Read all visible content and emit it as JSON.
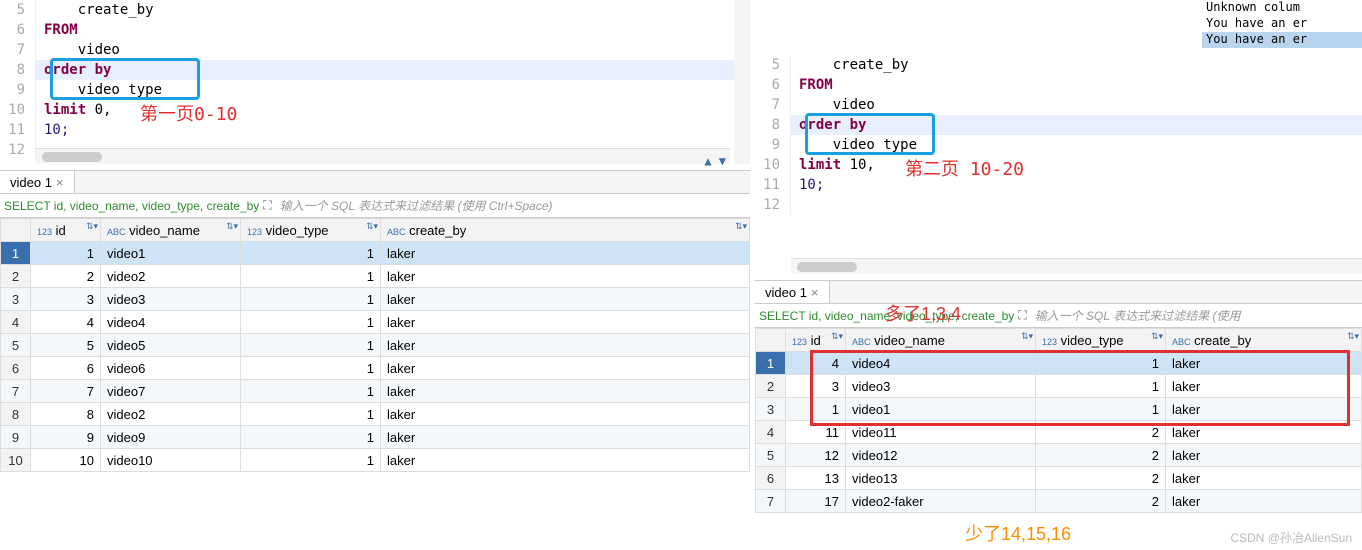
{
  "left": {
    "code": {
      "lines": [
        {
          "n": 5,
          "txt": "    create_by",
          "cls": ""
        },
        {
          "n": 6,
          "txt": "FROM",
          "cls": "kw"
        },
        {
          "n": 7,
          "txt": "    video",
          "cls": ""
        },
        {
          "n": 8,
          "txt": "order by",
          "cls": "kw",
          "current": true
        },
        {
          "n": 9,
          "txt": "    video_type",
          "cls": ""
        },
        {
          "n": 10,
          "pre": "limit ",
          "mid": "0,",
          "cls": "kw"
        },
        {
          "n": 11,
          "txt": "10;",
          "cls": "num"
        },
        {
          "n": 12,
          "txt": "",
          "cls": ""
        }
      ]
    },
    "annotation1": "第一页0-10",
    "tab": "video 1",
    "query": "SELECT id, video_name, video_type, create_by",
    "filter_placeholder": "输入一个 SQL 表达式来过滤结果 (使用 Ctrl+Space)",
    "headers": [
      "id",
      "video_name",
      "video_type",
      "create_by"
    ],
    "rows": [
      {
        "n": 1,
        "id": 1,
        "name": "video1",
        "type": 1,
        "by": "laker",
        "sel": true
      },
      {
        "n": 2,
        "id": 2,
        "name": "video2",
        "type": 1,
        "by": "laker"
      },
      {
        "n": 3,
        "id": 3,
        "name": "video3",
        "type": 1,
        "by": "laker",
        "alt": true
      },
      {
        "n": 4,
        "id": 4,
        "name": "video4",
        "type": 1,
        "by": "laker"
      },
      {
        "n": 5,
        "id": 5,
        "name": "video5",
        "type": 1,
        "by": "laker",
        "alt": true
      },
      {
        "n": 6,
        "id": 6,
        "name": "video6",
        "type": 1,
        "by": "laker"
      },
      {
        "n": 7,
        "id": 7,
        "name": "video7",
        "type": 1,
        "by": "laker",
        "alt": true
      },
      {
        "n": 8,
        "id": 8,
        "name": "video2",
        "type": 1,
        "by": "laker"
      },
      {
        "n": 9,
        "id": 9,
        "name": "video9",
        "type": 1,
        "by": "laker",
        "alt": true
      },
      {
        "n": 10,
        "id": 10,
        "name": "video10",
        "type": 1,
        "by": "laker"
      }
    ]
  },
  "right": {
    "console": [
      "Unknown colum",
      "You have an er",
      "You have an er"
    ],
    "code": {
      "lines": [
        {
          "n": 5,
          "txt": "    create_by",
          "cls": ""
        },
        {
          "n": 6,
          "txt": "FROM",
          "cls": "kw"
        },
        {
          "n": 7,
          "txt": "    video",
          "cls": ""
        },
        {
          "n": 8,
          "txt": "order by",
          "cls": "kw",
          "current": true
        },
        {
          "n": 9,
          "txt": "    video_type",
          "cls": ""
        },
        {
          "n": 10,
          "pre": "limit ",
          "mid": "10,",
          "cls": "kw"
        },
        {
          "n": 11,
          "txt": "10;",
          "cls": "num"
        },
        {
          "n": 12,
          "txt": "",
          "cls": ""
        }
      ]
    },
    "annotation1": "第二页 10-20",
    "annotation2": "多了1,3,4",
    "annotation3": "少了14,15,16",
    "tab": "video 1",
    "query": "SELECT id, video_name, video_type, create_by",
    "filter_placeholder": "输入一个 SQL 表达式来过滤结果 (使用",
    "headers": [
      "id",
      "video_name",
      "video_type",
      "create_by"
    ],
    "rows": [
      {
        "n": 1,
        "id": 4,
        "name": "video4",
        "type": 1,
        "by": "laker",
        "sel": true
      },
      {
        "n": 2,
        "id": 3,
        "name": "video3",
        "type": 1,
        "by": "laker"
      },
      {
        "n": 3,
        "id": 1,
        "name": "video1",
        "type": 1,
        "by": "laker",
        "alt": true
      },
      {
        "n": 4,
        "id": 11,
        "name": "video11",
        "type": 2,
        "by": "laker"
      },
      {
        "n": 5,
        "id": 12,
        "name": "video12",
        "type": 2,
        "by": "laker",
        "alt": true
      },
      {
        "n": 6,
        "id": 13,
        "name": "video13",
        "type": 2,
        "by": "laker"
      },
      {
        "n": 7,
        "id": 17,
        "name": "video2-faker",
        "type": 2,
        "by": "laker",
        "alt": true
      }
    ]
  },
  "watermark": "CSDN @孙冶AllenSun"
}
